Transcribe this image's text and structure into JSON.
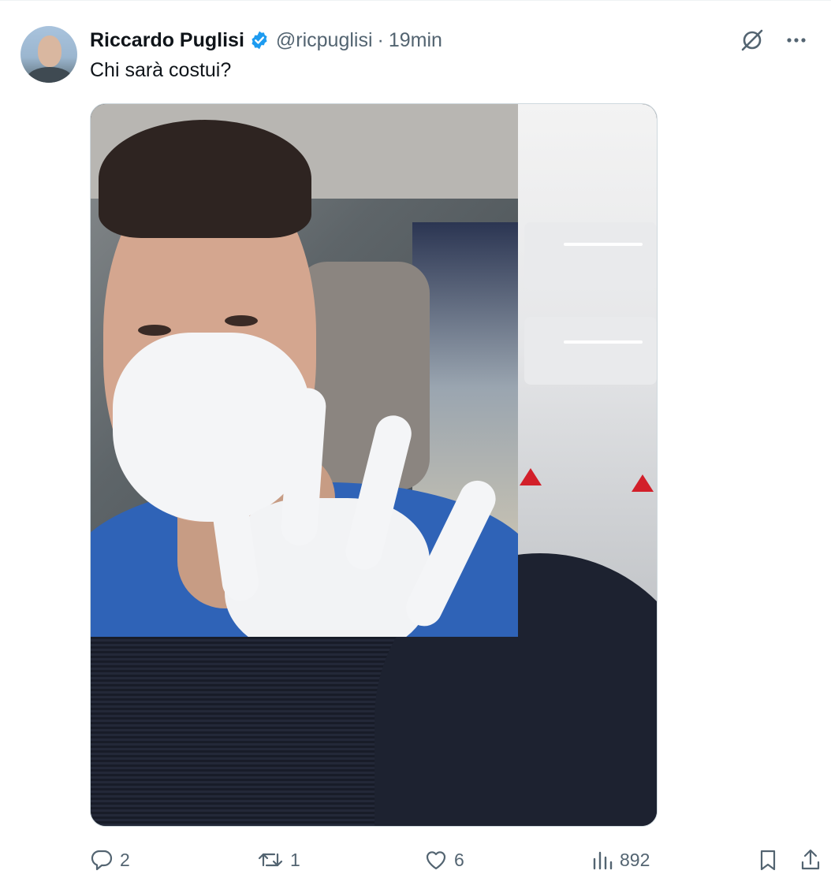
{
  "author": {
    "name": "Riccardo Puglisi",
    "handle": "@ricpuglisi",
    "separator": "·",
    "time": "19min",
    "verified_color": "#1d9bf0"
  },
  "tweet": {
    "text": "Chi sarà costui?"
  },
  "top_icons": [
    "grok-icon",
    "more-icon"
  ],
  "stats": {
    "replies": "2",
    "retweets": "1",
    "likes": "6",
    "views": "892"
  },
  "colors": {
    "text_primary": "#0f1419",
    "text_secondary": "#536471",
    "accent": "#1d9bf0"
  }
}
